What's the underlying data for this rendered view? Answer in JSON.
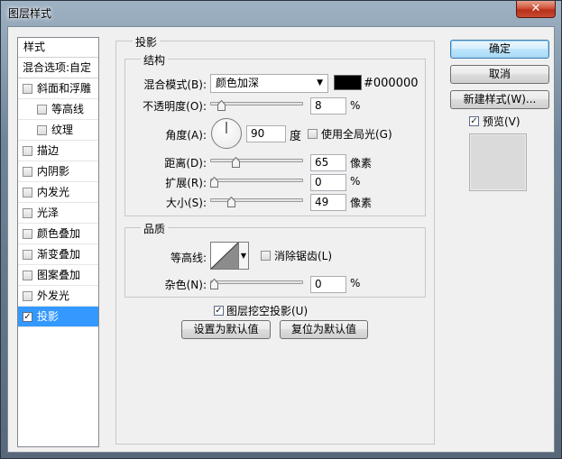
{
  "window": {
    "title": "图层样式",
    "close_glyph": "✕"
  },
  "sidebar": {
    "header": "样式",
    "blend_options": "混合选项:自定",
    "items": [
      {
        "label": "斜面和浮雕",
        "checked": false,
        "sub": false
      },
      {
        "label": "等高线",
        "checked": false,
        "sub": true
      },
      {
        "label": "纹理",
        "checked": false,
        "sub": true
      },
      {
        "label": "描边",
        "checked": false,
        "sub": false
      },
      {
        "label": "内阴影",
        "checked": false,
        "sub": false
      },
      {
        "label": "内发光",
        "checked": false,
        "sub": false
      },
      {
        "label": "光泽",
        "checked": false,
        "sub": false
      },
      {
        "label": "颜色叠加",
        "checked": false,
        "sub": false
      },
      {
        "label": "渐变叠加",
        "checked": false,
        "sub": false
      },
      {
        "label": "图案叠加",
        "checked": false,
        "sub": false
      },
      {
        "label": "外发光",
        "checked": false,
        "sub": false
      },
      {
        "label": "投影",
        "checked": true,
        "sub": false,
        "selected": true
      }
    ]
  },
  "drop_shadow": {
    "title": "投影",
    "structure": {
      "title": "结构",
      "blend_mode_label": "混合模式(B):",
      "blend_mode_value": "颜色加深",
      "color_hex": "#000000",
      "color_value": "#000000",
      "opacity_label": "不透明度(O):",
      "opacity_value": "8",
      "opacity_unit": "%",
      "opacity_fraction": 0.08,
      "angle_label": "角度(A):",
      "angle_value": "90",
      "angle_unit": "度",
      "global_light_label": "使用全局光(G)",
      "global_light_checked": false,
      "distance_label": "距离(D):",
      "distance_value": "65",
      "distance_unit": "像素",
      "distance_fraction": 0.26,
      "spread_label": "扩展(R):",
      "spread_value": "0",
      "spread_unit": "%",
      "spread_fraction": 0.0,
      "size_label": "大小(S):",
      "size_value": "49",
      "size_unit": "像素",
      "size_fraction": 0.2
    },
    "quality": {
      "title": "品质",
      "contour_label": "等高线:",
      "antialias_label": "消除锯齿(L)",
      "antialias_checked": false,
      "noise_label": "杂色(N):",
      "noise_value": "0",
      "noise_unit": "%",
      "noise_fraction": 0.0
    },
    "knockout_label": "图层挖空投影(U)",
    "knockout_checked": true,
    "make_default_label": "设置为默认值",
    "reset_default_label": "复位为默认值"
  },
  "actions": {
    "ok_label": "确定",
    "cancel_label": "取消",
    "new_style_label": "新建样式(W)...",
    "preview_label": "预览(V)",
    "preview_checked": true
  },
  "icons": {
    "checkbox_check": "✓",
    "dropdown_arrow": "▼"
  }
}
